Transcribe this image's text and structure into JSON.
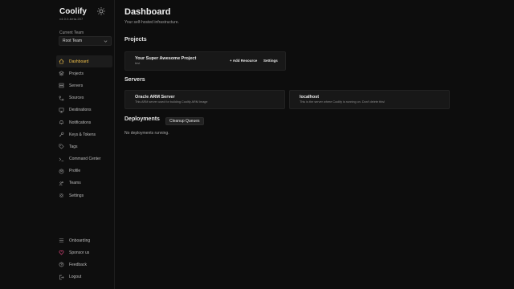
{
  "sidebar": {
    "brand": "Coolify",
    "version": "v4.0.0-beta.207",
    "team_label": "Current Team",
    "team_value": "Root Team",
    "items": [
      {
        "label": "Dashboard",
        "icon": "home-icon",
        "active": true
      },
      {
        "label": "Projects",
        "icon": "layers-icon"
      },
      {
        "label": "Servers",
        "icon": "server-icon"
      },
      {
        "label": "Sources",
        "icon": "git-branch-icon"
      },
      {
        "label": "Destinations",
        "icon": "network-icon"
      },
      {
        "label": "Notifications",
        "icon": "bell-icon"
      },
      {
        "label": "Keys & Tokens",
        "icon": "key-icon"
      },
      {
        "label": "Tags",
        "icon": "tag-icon"
      },
      {
        "label": "Command Center",
        "icon": "terminal-icon"
      },
      {
        "label": "Profile",
        "icon": "user-icon"
      },
      {
        "label": "Teams",
        "icon": "users-icon"
      },
      {
        "label": "Settings",
        "icon": "gear-icon"
      }
    ],
    "bottom_items": [
      {
        "label": "Onboarding",
        "icon": "list-icon"
      },
      {
        "label": "Sponsor us",
        "icon": "heart-icon"
      },
      {
        "label": "Feedback",
        "icon": "help-icon"
      },
      {
        "label": "Logout",
        "icon": "logout-icon"
      }
    ]
  },
  "main": {
    "title": "Dashboard",
    "subtitle": "Your self-hosted infrastructure.",
    "projects_heading": "Projects",
    "project": {
      "name": "Your Super Awesome Project",
      "desc": "test",
      "add_resource": "+ Add Resource",
      "settings": "Settings"
    },
    "servers_heading": "Servers",
    "servers": [
      {
        "name": "Oracle ARM Server",
        "desc": "This ARM server used for building Coolify ARM Image"
      },
      {
        "name": "localhost",
        "desc": "This is the server where Coolify is running on. Don't delete this!"
      }
    ],
    "deployments_heading": "Deployments",
    "cleanup_button": "Cleanup Queues",
    "deployments_empty": "No deployments running."
  },
  "colors": {
    "accent": "#f0c04a",
    "heart": "#e0457b"
  }
}
